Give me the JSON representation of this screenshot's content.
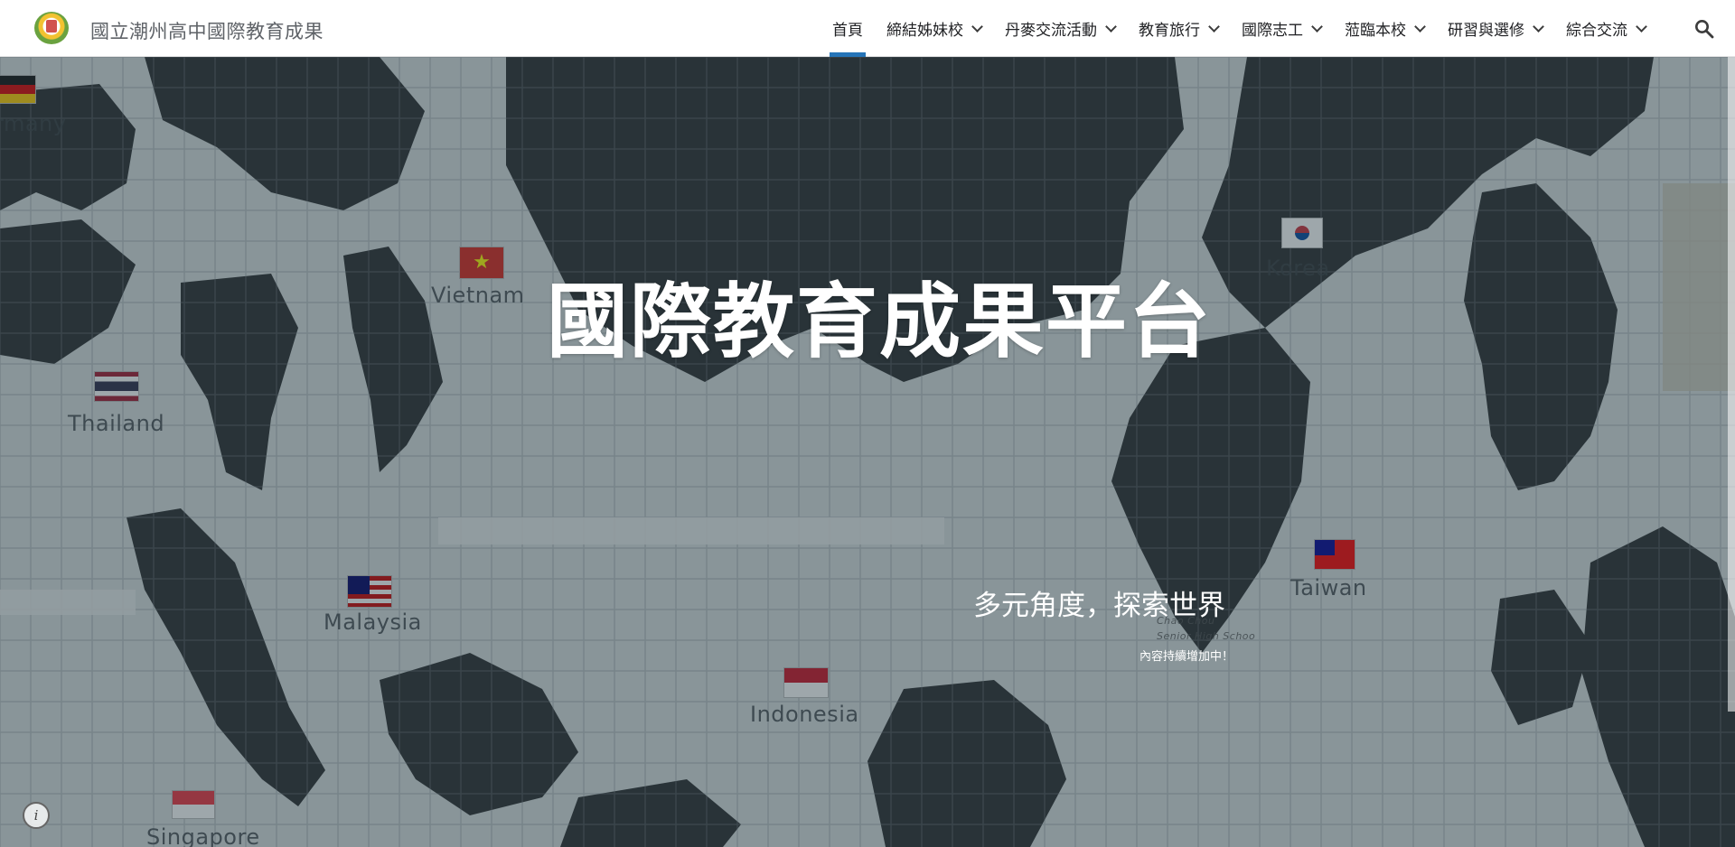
{
  "site": {
    "title": "國立潮州高中國際教育成果"
  },
  "nav": {
    "items": [
      {
        "label": "首頁",
        "active": true,
        "dropdown": false
      },
      {
        "label": "締結姊妹校",
        "active": false,
        "dropdown": true
      },
      {
        "label": "丹麥交流活動",
        "active": false,
        "dropdown": true
      },
      {
        "label": "教育旅行",
        "active": false,
        "dropdown": true
      },
      {
        "label": "國際志工",
        "active": false,
        "dropdown": true
      },
      {
        "label": "蒞臨本校",
        "active": false,
        "dropdown": true
      },
      {
        "label": "研習與選修",
        "active": false,
        "dropdown": true
      },
      {
        "label": "綜合交流",
        "active": false,
        "dropdown": true
      }
    ],
    "search_icon": "search-icon",
    "accent_color": "#2574b8"
  },
  "hero": {
    "title": "國際教育成果平台",
    "subtitle": "多元角度，探索世界",
    "note": "內容持續增加中！",
    "map_labels": {
      "germany": "rmany",
      "vietnam": "Vietnam",
      "thailand": "Thailand",
      "korea": "Korea",
      "malaysia": "Malaysia",
      "indonesia": "Indonesia",
      "taiwan": "Taiwan",
      "singapore": "Singapore",
      "school_line1": "Chao Chou",
      "school_line2": "Senior High Schoo"
    },
    "info_icon": "info-icon"
  }
}
